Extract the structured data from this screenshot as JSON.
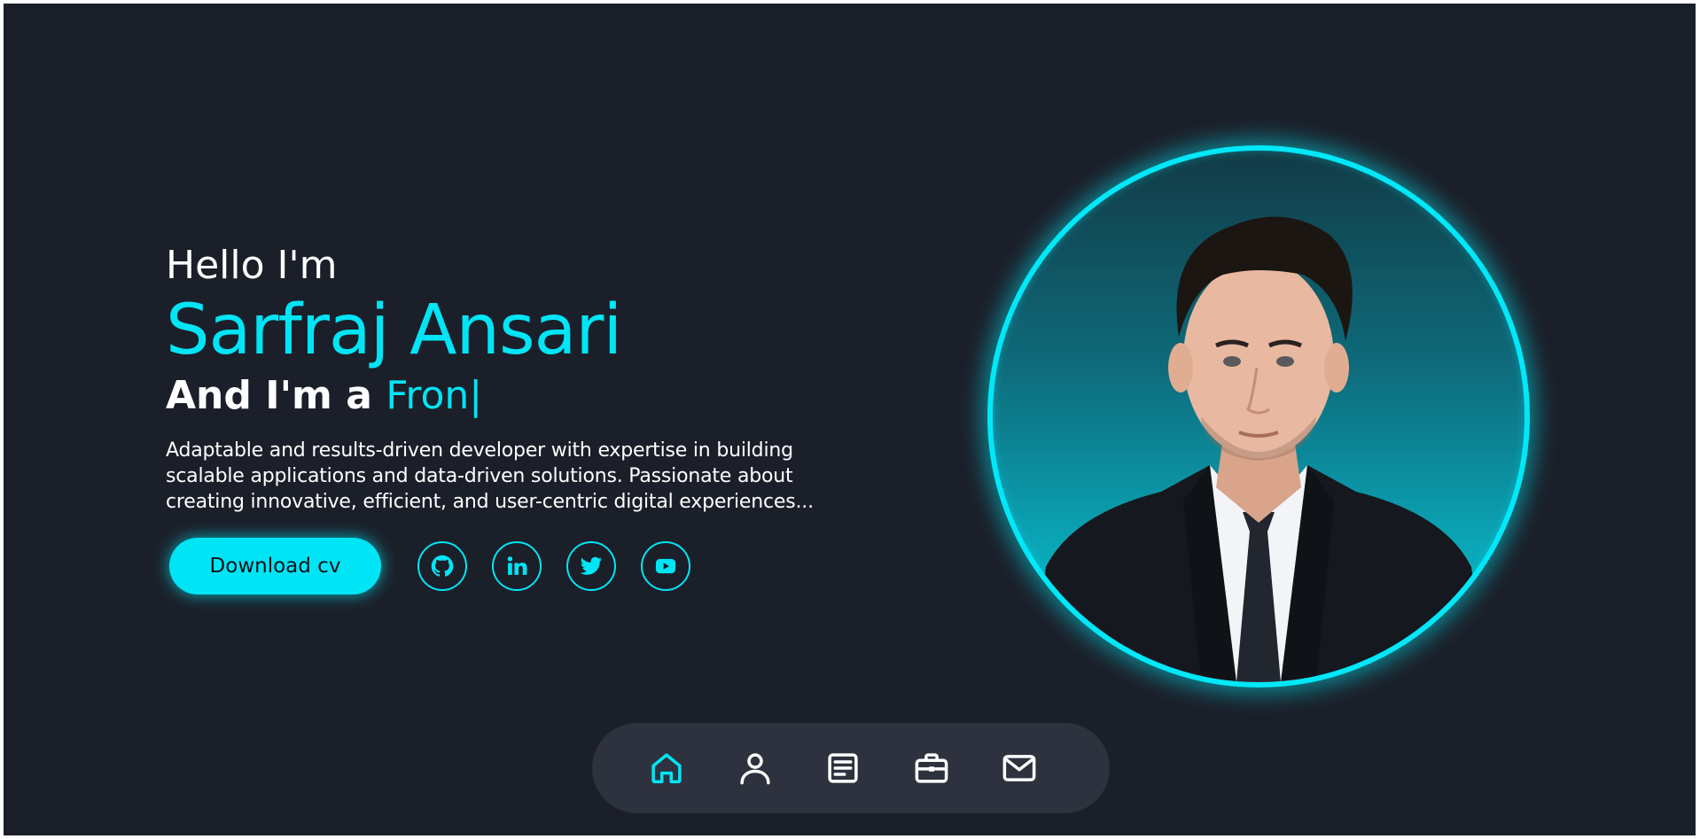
{
  "hero": {
    "greeting": "Hello I'm",
    "name": "Sarfraj Ansari",
    "role_prefix": "And I'm a ",
    "role_typed": "Fron|",
    "description": "Adaptable and results-driven developer with expertise in building scalable applications and data-driven solutions. Passionate about creating innovative, efficient, and user-centric digital experiences..."
  },
  "actions": {
    "download_label": "Download cv",
    "socials": [
      {
        "icon": "github-icon"
      },
      {
        "icon": "linkedin-icon"
      },
      {
        "icon": "twitter-icon"
      },
      {
        "icon": "youtube-icon"
      }
    ]
  },
  "profile_photo": {
    "icon": "profile-photo"
  },
  "bottom_nav": {
    "items": [
      {
        "icon": "home-icon",
        "active": true
      },
      {
        "icon": "user-icon",
        "active": false
      },
      {
        "icon": "resume-icon",
        "active": false
      },
      {
        "icon": "briefcase-icon",
        "active": false
      },
      {
        "icon": "mail-icon",
        "active": false
      }
    ]
  },
  "colors": {
    "background": "#1b1f29",
    "accent": "#00e5f5",
    "nav_background": "#2d323e",
    "text": "#ffffff"
  }
}
